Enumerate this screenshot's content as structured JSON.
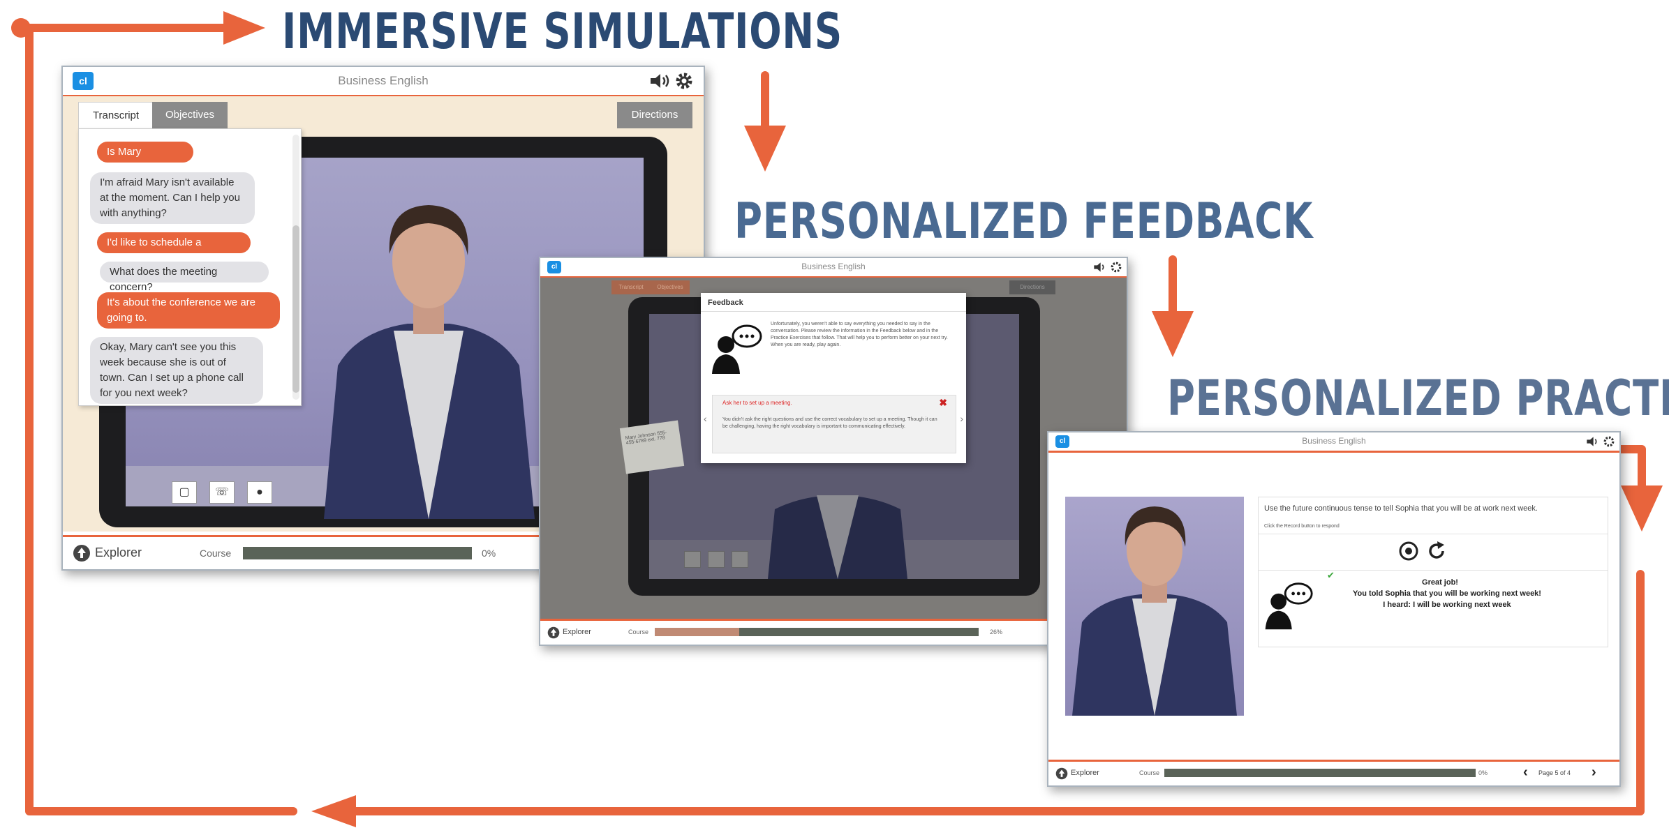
{
  "headings": {
    "immersive": "IMMERSIVE SIMULATIONS",
    "feedback": "PERSONALIZED FEEDBACK",
    "practice": "PERSONALIZED PRACTICE"
  },
  "colors": {
    "heading": "#2b4a73",
    "heading_light": "#4a6a92",
    "accent": "#e8643c",
    "logo": "#1a8fe3",
    "progress": "#5a6358"
  },
  "app_title": "Business English",
  "window1": {
    "logo": "cl",
    "tabs": [
      "Transcript",
      "Objectives"
    ],
    "directions": "Directions",
    "transcript": [
      {
        "role": "user",
        "text": "Is Mary available?"
      },
      {
        "role": "agent",
        "text": "I'm afraid Mary isn't available at the moment. Can I help you with anything?"
      },
      {
        "role": "user",
        "text": "I'd like to schedule a meeting."
      },
      {
        "role": "agent",
        "text": "What does the meeting concern?"
      },
      {
        "role": "user",
        "text": "It's about the conference we are going to."
      },
      {
        "role": "agent",
        "text": "Okay, Mary can't see you this week because she is out of town. Can I set up a phone call for you next week?"
      }
    ],
    "footer": {
      "explorer": "Explorer",
      "course": "Course",
      "progress": 0,
      "pct": "0%"
    }
  },
  "window2": {
    "logo": "cl",
    "tabs": [
      "Transcript",
      "Objectives"
    ],
    "directions": "Directions",
    "feedback_title": "Feedback",
    "feedback_text": "Unfortunately, you weren't able to say everything you needed to say in the conversation. Please review the information in the Feedback below and in the Practice Exercises that follow. That will help you to perform better on your next try. When you are ready, play again.",
    "issue_title": "Ask her to set up a meeting.",
    "issue_text": "You didn't ask the right questions and use the correct vocabulary to set up a meeting. Though it can be challenging, having the right vocabulary is important to communicating effectively.",
    "card_text": "Mary Johnson 555-455-6789 ext. 778",
    "footer": {
      "explorer": "Explorer",
      "course": "Course",
      "progress": 0.26,
      "pct": "26%"
    }
  },
  "window3": {
    "logo": "cl",
    "instruction": "Use the future continuous tense to tell Sophia that you will be at work next week.",
    "hint": "Click the Record button to respond",
    "result_title": "Great job!",
    "result_told": "You told Sophia that you will be working next week!",
    "result_heard": "I heard:  I will be working next week",
    "footer": {
      "explorer": "Explorer",
      "course": "Course",
      "progress": 0,
      "pct": "0%",
      "page": "Page 5 of 4"
    }
  }
}
